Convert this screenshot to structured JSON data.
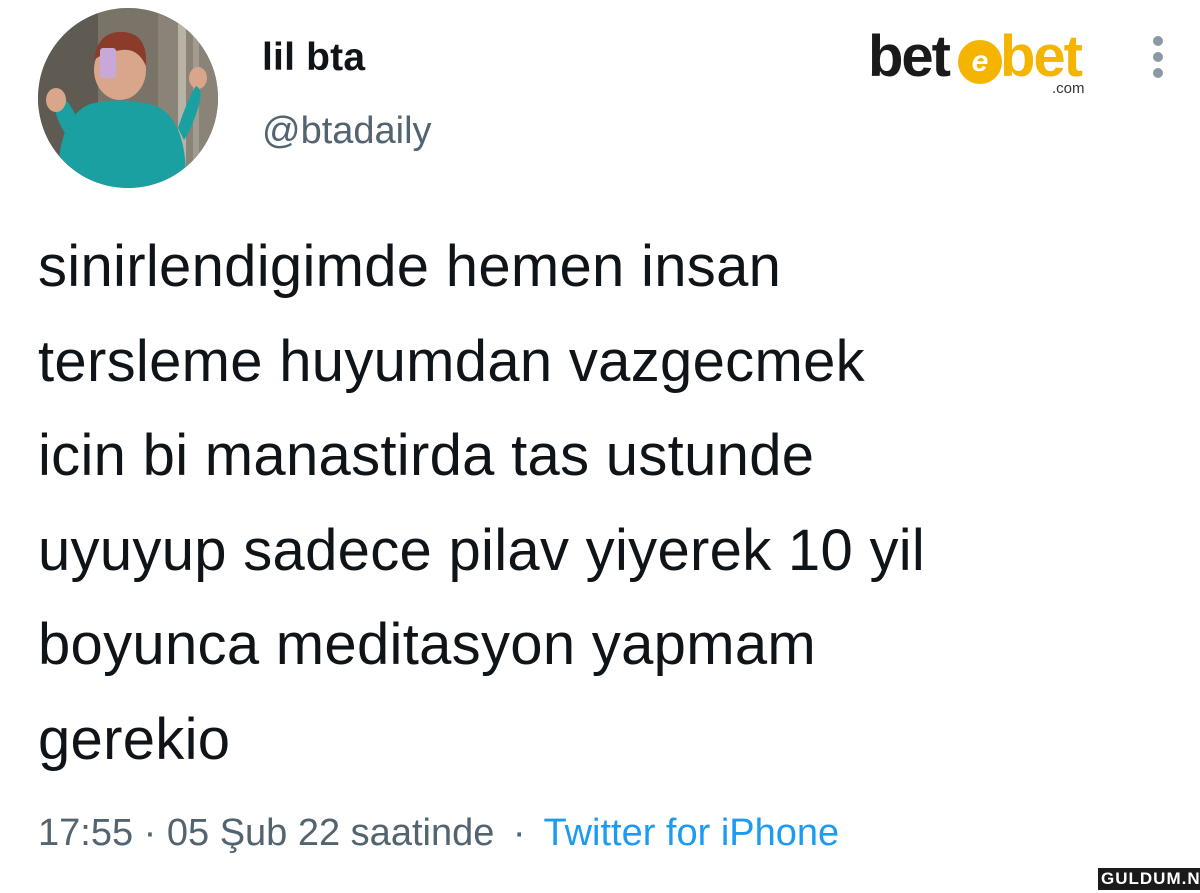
{
  "tweet": {
    "display_name": "lil bta",
    "handle": "@btadaily",
    "text": "sinirlendigimde hemen insan\ntersleme huyumdan vazgecmek\nicin bi manastirda tas ustunde\nuyuyup sadece pilav yiyerek 10 yil\nboyunca meditasyon yapmam\ngerekio",
    "timestamp": "17:55 · 05 Şub 22 saatinde",
    "separator": "·",
    "source": "Twitter for iPhone"
  },
  "branding": {
    "logo_left": "bet",
    "logo_mark": "e",
    "logo_right": "bet",
    "logo_domain": ".com",
    "watermark": "GULDUM.NET"
  },
  "icons": {
    "more": "more-vertical-icon",
    "avatar": "profile-photo"
  },
  "colors": {
    "text": "#0f1419",
    "secondary": "#536471",
    "link": "#1d9bf0",
    "brand_accent": "#f5b400"
  }
}
